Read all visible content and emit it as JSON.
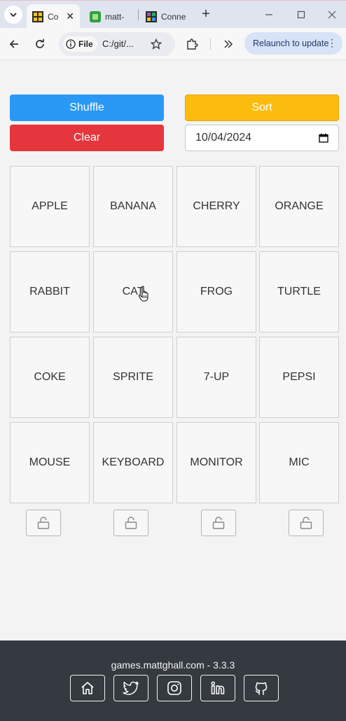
{
  "browser": {
    "tabs": [
      {
        "title": "Co",
        "active": true,
        "icon": "grid-favicon-icon"
      },
      {
        "title": "matt-",
        "active": false,
        "icon": "green-favicon-icon"
      },
      {
        "title": "Conne",
        "active": false,
        "icon": "grid-favicon-icon"
      }
    ],
    "address": {
      "scheme_chip": "File",
      "url": "C:/git/..."
    },
    "relaunch_label": "Relaunch to update"
  },
  "controls": {
    "shuffle_label": "Shuffle",
    "sort_label": "Sort",
    "clear_label": "Clear",
    "date_value": "10/04/2024",
    "colors": {
      "shuffle": "#2a98f5",
      "sort": "#fbbc0e",
      "clear": "#e5353d"
    }
  },
  "grid": {
    "rows": [
      [
        "APPLE",
        "BANANA",
        "CHERRY",
        "ORANGE"
      ],
      [
        "RABBIT",
        "CAT",
        "FROG",
        "TURTLE"
      ],
      [
        "COKE",
        "SPRITE",
        "7-UP",
        "PEPSI"
      ],
      [
        "MOUSE",
        "KEYBOARD",
        "MONITOR",
        "MIC"
      ]
    ]
  },
  "locks": {
    "icon": "unlocked-padlock-icon",
    "count_state": "unlocked"
  },
  "footer": {
    "text": "games.mattghall.com - 3.3.3",
    "links": [
      "home-icon",
      "twitter-icon",
      "instagram-icon",
      "linkedin-icon",
      "github-icon"
    ]
  }
}
